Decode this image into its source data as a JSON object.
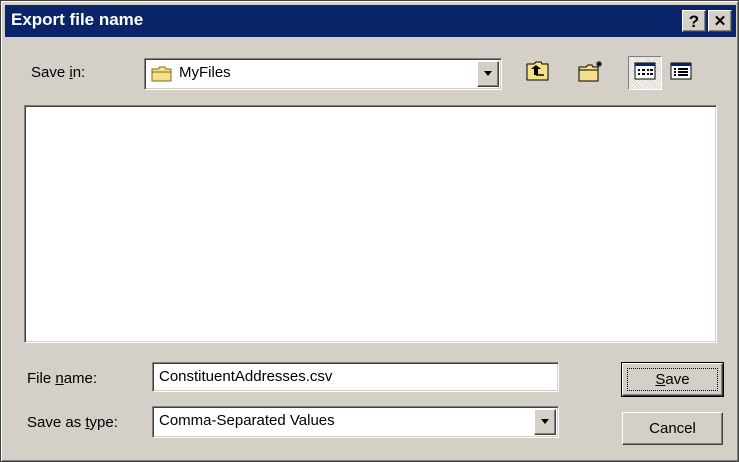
{
  "window": {
    "title": "Export file name",
    "help_glyph": "?",
    "close_glyph": "✕"
  },
  "save_in": {
    "label_pre": "Save ",
    "label_accel": "i",
    "label_post": "n:",
    "value": "MyFiles",
    "icon": "folder-icon"
  },
  "toolbar": {
    "buttons": [
      {
        "name": "up-one-level",
        "icon": "up-folder-icon"
      },
      {
        "name": "create-new-folder",
        "icon": "new-folder-icon"
      },
      {
        "name": "list-view",
        "icon": "list-view-icon",
        "pressed": true
      },
      {
        "name": "details-view",
        "icon": "details-view-icon",
        "pressed": false
      }
    ]
  },
  "file_name": {
    "label_pre": "File ",
    "label_accel": "n",
    "label_post": "ame:",
    "value": "ConstituentAddresses.csv"
  },
  "save_as_type": {
    "label_pre": "Save as ",
    "label_accel": "t",
    "label_post": "ype:",
    "value": "Comma-Separated Values"
  },
  "buttons": {
    "save_accel": "S",
    "save_rest": "ave",
    "cancel": "Cancel"
  },
  "colors": {
    "titlebar": "#0a246a",
    "face": "#d4d0c8",
    "folder": "#f5e08a"
  }
}
